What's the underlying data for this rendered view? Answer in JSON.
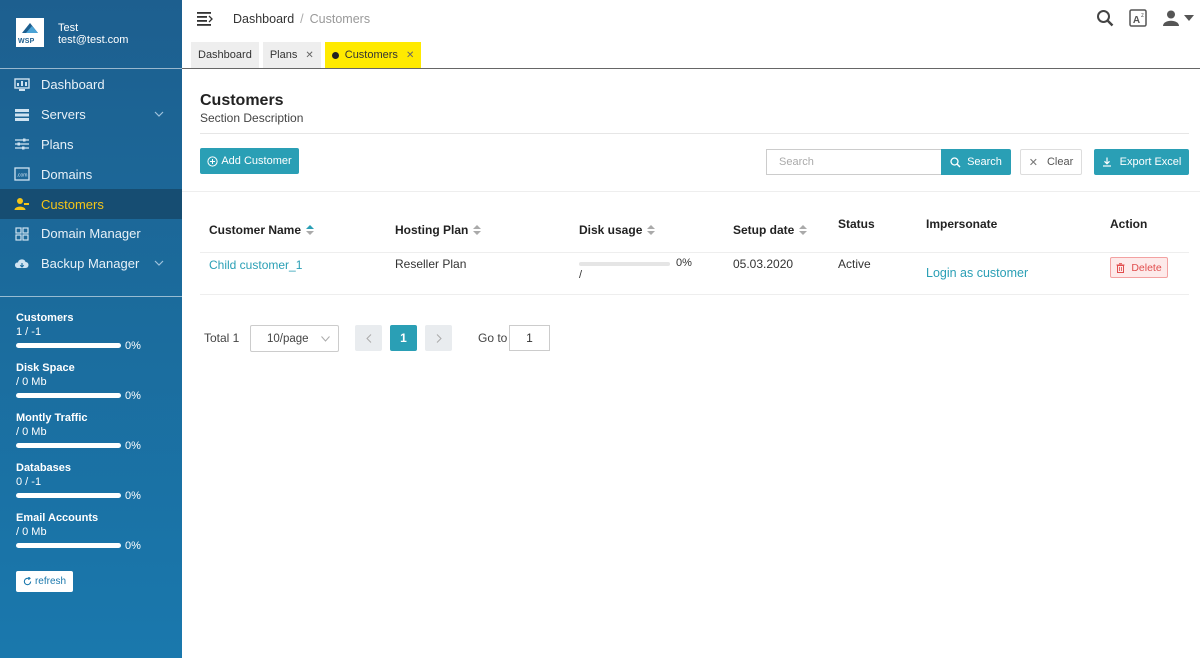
{
  "sidebar": {
    "logo_text": "WSP",
    "user": {
      "name": "Test",
      "email": "test@test.com"
    },
    "menu": [
      {
        "label": "Dashboard",
        "icon": "dashboard-icon",
        "has_submenu": false,
        "active": false
      },
      {
        "label": "Servers",
        "icon": "servers-icon",
        "has_submenu": true,
        "active": false
      },
      {
        "label": "Plans",
        "icon": "plans-icon",
        "has_submenu": false,
        "active": false
      },
      {
        "label": "Domains",
        "icon": "domains-icon",
        "has_submenu": false,
        "active": false
      },
      {
        "label": "Customers",
        "icon": "customers-icon",
        "has_submenu": false,
        "active": true
      },
      {
        "label": "Domain Manager",
        "icon": "domain-manager-icon",
        "has_submenu": false,
        "active": false
      },
      {
        "label": "Backup Manager",
        "icon": "backup-manager-icon",
        "has_submenu": true,
        "active": false
      }
    ],
    "stats": [
      {
        "title": "Customers",
        "value": "1 / -1",
        "percent": "0%"
      },
      {
        "title": "Disk Space",
        "value": "/ 0 Mb",
        "percent": "0%"
      },
      {
        "title": "Montly Traffic",
        "value": "/ 0 Mb",
        "percent": "0%"
      },
      {
        "title": "Databases",
        "value": "0 / -1",
        "percent": "0%"
      },
      {
        "title": "Email Accounts",
        "value": "/ 0 Mb",
        "percent": "0%"
      }
    ],
    "refresh_label": "refresh"
  },
  "topbar": {
    "breadcrumb": {
      "home": "Dashboard",
      "separator": "/",
      "current": "Customers"
    },
    "icons": [
      "search-icon",
      "translate-icon",
      "user-icon",
      "caret-down-icon"
    ]
  },
  "tabs": [
    {
      "label": "Dashboard",
      "closable": false,
      "active": false
    },
    {
      "label": "Plans",
      "closable": true,
      "active": false
    },
    {
      "label": "Customers",
      "closable": true,
      "active": true
    }
  ],
  "page": {
    "title": "Customers",
    "description": "Section Description",
    "add_button": "Add Customer",
    "search_placeholder": "Search",
    "search_button": "Search",
    "clear_button": "Clear",
    "export_button": "Export Excel"
  },
  "table": {
    "columns": [
      "Customer Name",
      "Hosting Plan",
      "Disk usage",
      "Setup date",
      "Status",
      "Impersonate",
      "Action"
    ],
    "rows": [
      {
        "customer_name": "Child customer_1",
        "hosting_plan": "Reseller Plan",
        "disk_usage_percent": "0%",
        "disk_usage_detail": "/",
        "setup_date": "05.03.2020",
        "status": "Active",
        "impersonate": "Login as customer",
        "action": "Delete"
      }
    ]
  },
  "pagination": {
    "total_label": "Total 1",
    "page_size": "10/page",
    "current_page": "1",
    "goto_label": "Go to",
    "goto_value": "1"
  },
  "colors": {
    "sidebar_top": "#1d5f8f",
    "sidebar_bottom": "#1a78ad",
    "active_menu_text": "#f5c518",
    "accent": "#2a9fb5",
    "active_tab": "#ffea00",
    "danger": "#e14d4d"
  }
}
